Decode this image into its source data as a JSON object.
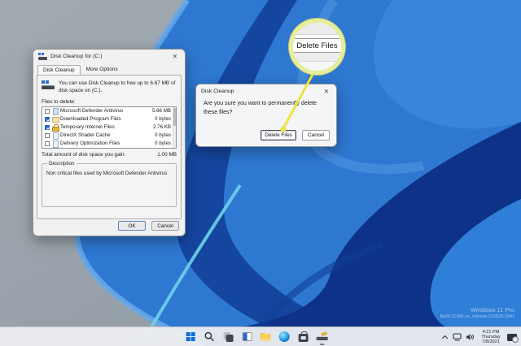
{
  "desktop": {
    "watermark": {
      "line1": "Windows 11 Pro",
      "line2": "Build 21996.co_release.210529-1541"
    },
    "wallpaper_colors": {
      "sky_gray": "#9aa3ab",
      "bloom_mid": "#2e78d2",
      "bloom_dark": "#0d3287",
      "bloom_light": "#66a8ea",
      "highlight_cyan": "#6fd0ea"
    }
  },
  "cleanup_window": {
    "title": "Disk Cleanup for (C:)",
    "close_glyph": "✕",
    "tabs": {
      "disk_cleanup": "Disk Cleanup",
      "more_options": "More Options"
    },
    "intro_text": "You can use Disk Cleanup to free up to 6.67 MB of disk space on (C:).",
    "files_label": "Files to delete:",
    "files": [
      {
        "name": "Microsoft Defender Antivirus",
        "size": "5.66 MB",
        "checked": "false",
        "icon": "file-blue"
      },
      {
        "name": "Downloaded Program Files",
        "size": "0 bytes",
        "checked": "true",
        "icon": "folder"
      },
      {
        "name": "Temporary Internet Files",
        "size": "2.76 KB",
        "checked": "true",
        "icon": "lock"
      },
      {
        "name": "DirectX Shader Cache",
        "size": "0 bytes",
        "checked": "false",
        "icon": "file"
      },
      {
        "name": "Delivery Optimization Files",
        "size": "0 bytes",
        "checked": "false",
        "icon": "file"
      }
    ],
    "total_label": "Total amount of disk space you gain:",
    "total_value": "1.00 MB",
    "description_label": "Description",
    "description_text": "Non critical files used by Microsoft Defender Antivirus",
    "buttons": {
      "ok": "OK",
      "cancel": "Cancel"
    }
  },
  "confirm_dialog": {
    "title": "Disk Cleanup",
    "close_glyph": "✕",
    "message": "Are you sure you want to permanently delete these files?",
    "buttons": {
      "delete": "Delete Files",
      "cancel": "Cancel"
    }
  },
  "callout": {
    "label": "Delete Files",
    "ring_color": "#e7ed9e",
    "line_color": "#eee43e"
  },
  "taskbar": {
    "icons": [
      "start",
      "search",
      "task-view",
      "widgets",
      "file-explorer",
      "edge",
      "microsoft-store",
      "disk-cleanup"
    ],
    "active_icon": "disk-cleanup"
  },
  "tray": {
    "time": "4:21 PM",
    "day": "Thursday",
    "date": "7/8/2021",
    "icons": [
      "chevron-up",
      "network",
      "volume",
      "tray-app"
    ]
  }
}
